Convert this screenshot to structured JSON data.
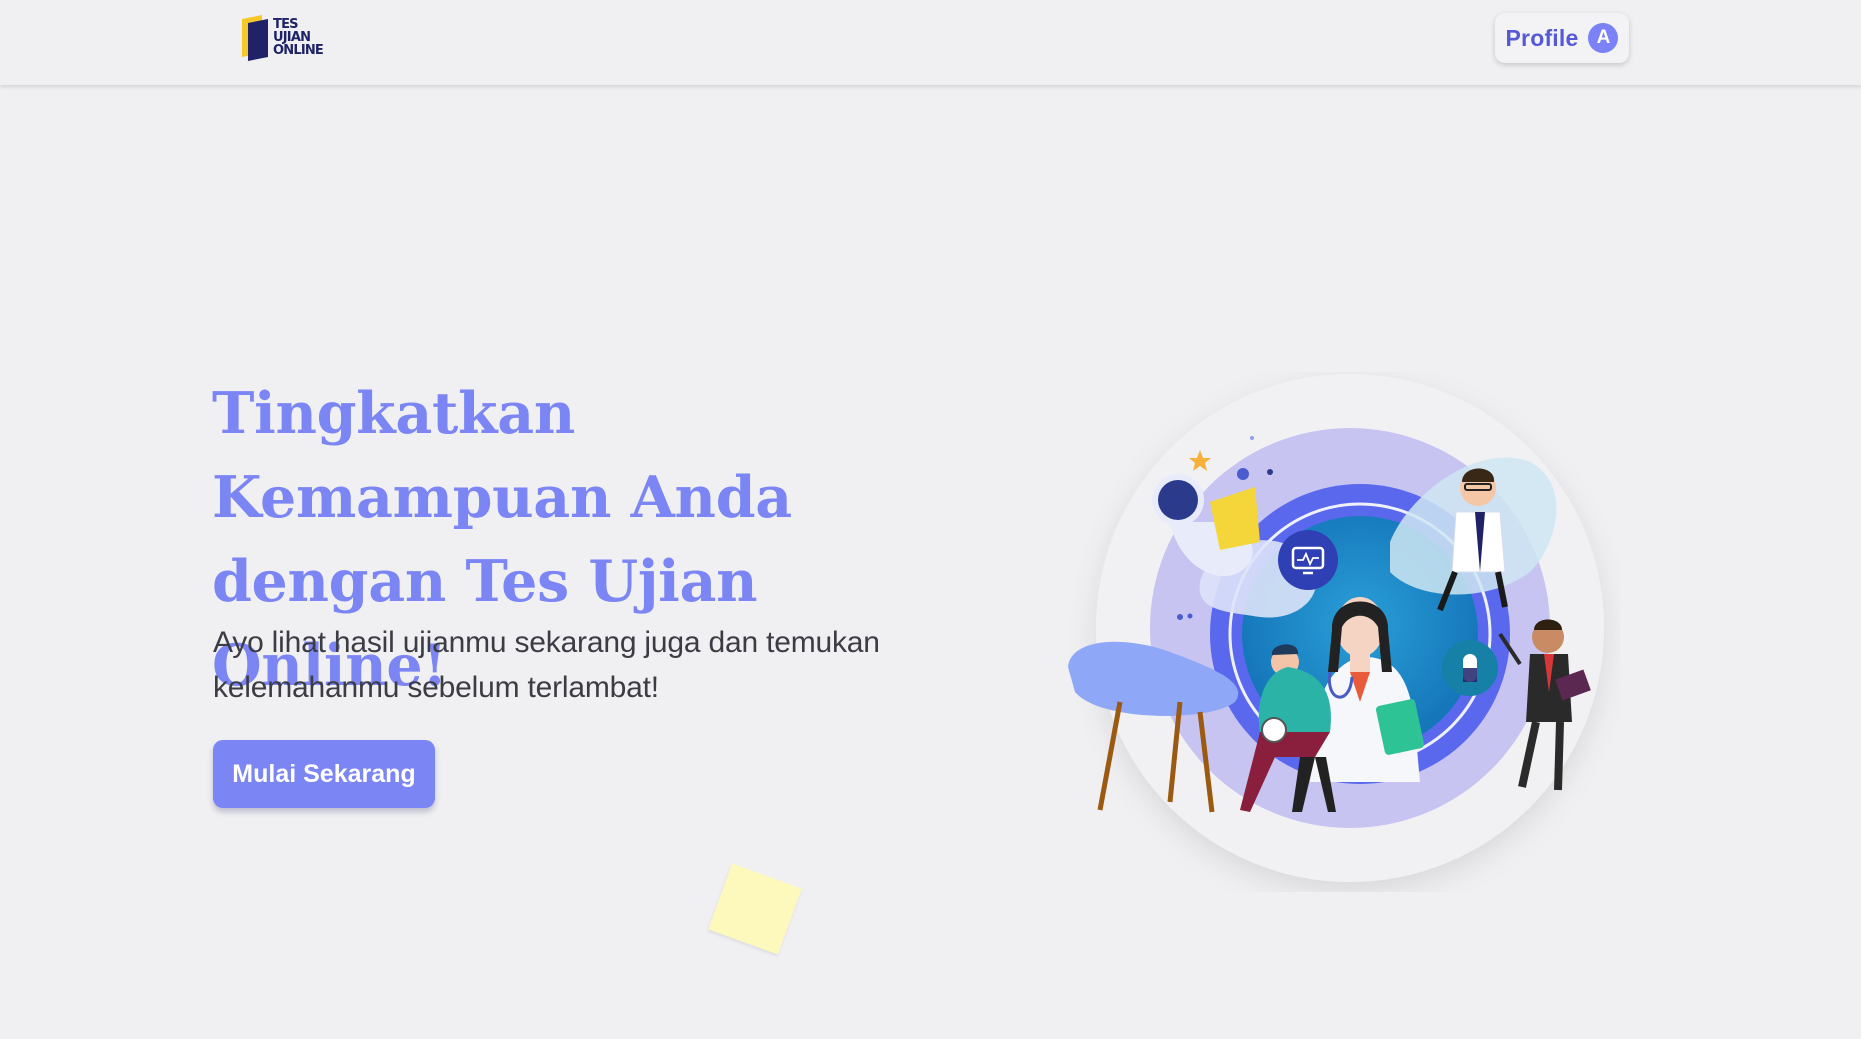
{
  "brand": {
    "logo_lines": [
      "TES",
      "UJIAN",
      "ONLINE"
    ],
    "colors": {
      "navy": "#1f2266",
      "yellow": "#f7c928",
      "accent": "#7b85f4",
      "accent_dark": "#5559d6"
    }
  },
  "navbar": {
    "profile_label": "Profile",
    "avatar_initial": "A"
  },
  "hero": {
    "title": "Tingkatkan Kemampuan Anda dengan Tes Ujian Online!",
    "subtitle": "Ayo lihat hasil ujianmu sekarang juga dan temukan kelemahanmu sebelum terlambat!",
    "cta_label": "Mulai Sekarang"
  },
  "illustration": {
    "icons": [
      "monitor-icon",
      "pill-icon",
      "star-icon"
    ]
  }
}
